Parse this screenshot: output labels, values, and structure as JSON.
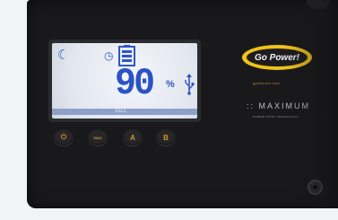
{
  "lcd": {
    "moon_glyph": "☾",
    "clock_glyph": "◷",
    "percent_value": "90",
    "percent_sign": "%",
    "bar_label": "ADJ"
  },
  "buttons": {
    "power_glyph": "⏻",
    "mode_label": "MAX",
    "a_label": "A",
    "b_label": "B"
  },
  "branding": {
    "logo_text": "Go Power!",
    "website": "gpelectric.com",
    "maximum_text": ":: MAXIMUM",
    "maximum_sub": "POWER POINT TECHNOLOGY"
  },
  "colors": {
    "lcd_segment": "#2f56c5",
    "logo_yellow": "#f0c21b",
    "button_glyph": "#c79a2e"
  }
}
